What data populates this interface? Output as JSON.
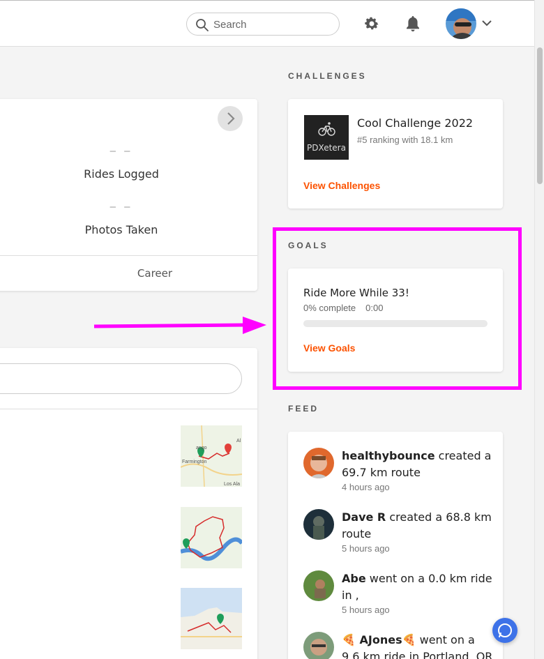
{
  "header": {
    "search_placeholder": "Search",
    "icons": [
      "search-icon",
      "gear-icon",
      "bell-icon",
      "avatar",
      "chevron-down-icon"
    ]
  },
  "stats": {
    "rides_logged_value": "– –",
    "rides_logged_label": "Rides Logged",
    "photos_taken_value": "– –",
    "photos_taken_label": "Photos Taken",
    "career_tab": "Career"
  },
  "challenges": {
    "section_title": "CHALLENGES",
    "logo_text": "PDXetera",
    "title": "Cool Challenge 2022",
    "subtitle": "#5 ranking with 18.1 km",
    "link": "View Challenges"
  },
  "goals": {
    "section_title": "GOALS",
    "title": "Ride More While 33!",
    "percent_text": "0% complete",
    "time_text": "0:00",
    "progress_fraction": 0,
    "link": "View Goals"
  },
  "feed": {
    "section_title": "FEED",
    "items": [
      {
        "user": "healthybounce",
        "action": " created a 69.7 km route",
        "time": "4 hours ago"
      },
      {
        "user": "Dave R",
        "action": " created a 68.8 km route",
        "time": "5 hours ago"
      },
      {
        "user": "Abe",
        "action": " went on a 0.0 km ride in ,",
        "time": "5 hours ago"
      },
      {
        "user": "🍕 AJones🍕",
        "action": " went on a 9.6 km ride in Portland, OR",
        "time": ""
      }
    ]
  },
  "map_labels": {
    "map1_a": "ango",
    "map1_b": "Farmington",
    "map1_c": "Los Ala",
    "map1_d": "Al"
  },
  "colors": {
    "accent": "#fc5200",
    "highlight": "#ff00ff",
    "chat": "#3d72e8"
  }
}
